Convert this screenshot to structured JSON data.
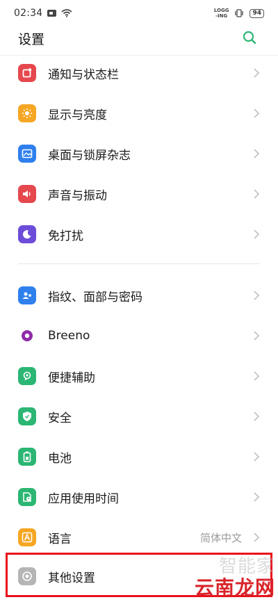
{
  "status_bar": {
    "time": "02:34",
    "logging_line1": "LOGG",
    "logging_line2": "-ING",
    "vibrate": "▯",
    "battery": "94"
  },
  "header": {
    "title": "设置",
    "search_icon": "search-icon"
  },
  "colors": {
    "accent": "#2bb673",
    "highlight": "#e8101a"
  },
  "items": [
    {
      "label": "通知与状态栏",
      "icon": "notification-icon",
      "color": "#e5484d"
    },
    {
      "label": "显示与亮度",
      "icon": "brightness-icon",
      "color": "#f5a623"
    },
    {
      "label": "桌面与锁屏杂志",
      "icon": "wallpaper-icon",
      "color": "#2f80ed"
    },
    {
      "label": "声音与振动",
      "icon": "sound-icon",
      "color": "#e5484d"
    },
    {
      "label": "免打扰",
      "icon": "moon-icon",
      "color": "#6c4cd9"
    },
    {
      "label": "指纹、面部与密码",
      "icon": "fingerprint-icon",
      "color": "#2f80ed"
    },
    {
      "label": "Breeno",
      "icon": "breeno-icon",
      "color": "#8e2ca8"
    },
    {
      "label": "便捷辅助",
      "icon": "assist-icon",
      "color": "#2bb673"
    },
    {
      "label": "安全",
      "icon": "shield-icon",
      "color": "#2bb673"
    },
    {
      "label": "电池",
      "icon": "battery-icon",
      "color": "#2bb673"
    },
    {
      "label": "应用使用时间",
      "icon": "app-usage-icon",
      "color": "#2bb673"
    },
    {
      "label": "语言",
      "icon": "language-icon",
      "color": "#f5a623",
      "value": "简体中文"
    },
    {
      "label": "其他设置",
      "icon": "other-settings-icon",
      "color": "#9e9e9e"
    }
  ],
  "watermark": {
    "line1": "智能家",
    "line2": "云南龙网"
  }
}
